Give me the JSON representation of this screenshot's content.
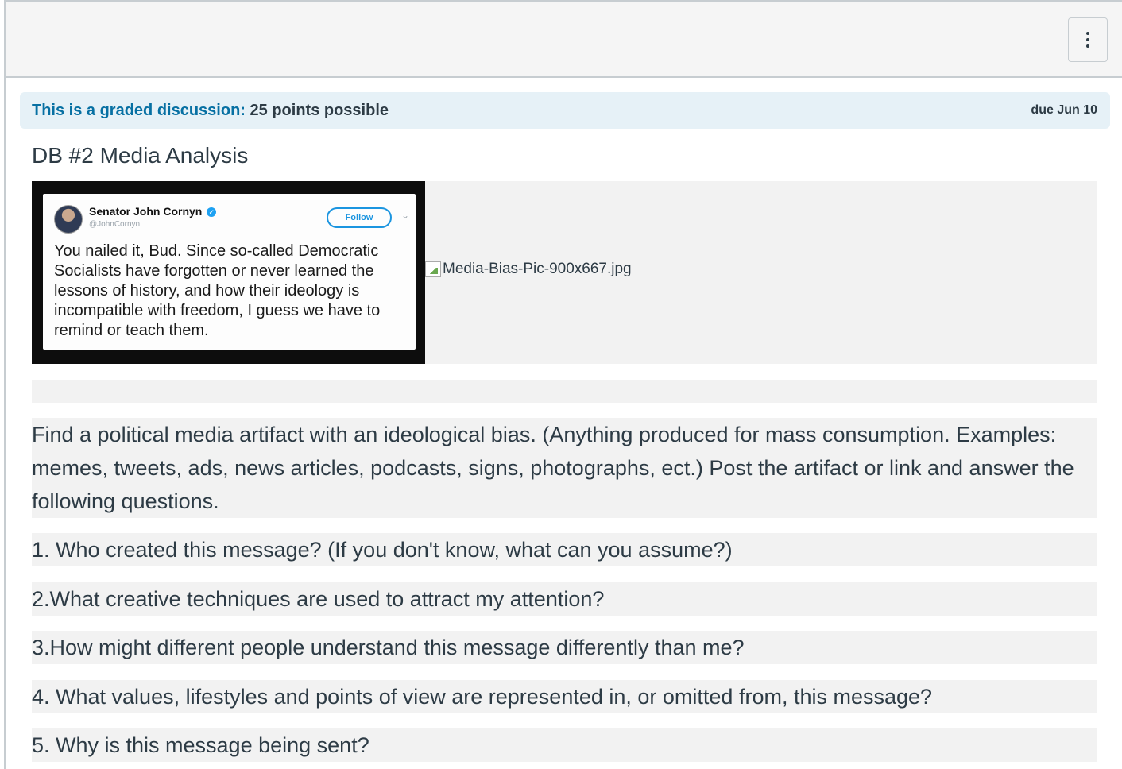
{
  "header": {
    "menu_icon": "kebab-vertical-icon"
  },
  "graded": {
    "link_text": "This is a graded discussion:",
    "points_text": " 25 points possible",
    "due_text": "due Jun 10"
  },
  "discussion": {
    "title": "DB #2 Media Analysis",
    "image_alt": "Media-Bias-Pic-900x667.jpg",
    "tweet": {
      "author": "Senator John Cornyn",
      "handle": "@JohnCornyn",
      "follow_label": "Follow",
      "text": "You nailed it, Bud.  Since so-called Democratic Socialists have forgotten or never learned the lessons of history, and how their ideology is incompatible with freedom, I guess we have to remind or teach them."
    },
    "prompt": "Find a political media artifact with an ideological bias. (Anything produced for mass consumption. Examples: memes, tweets, ads, news articles, podcasts, signs, photographs, ect.) Post the artifact or link and answer the following questions.",
    "questions": [
      "1. Who created this message? (If you don't know, what can you assume?)",
      "2.What creative techniques are used to attract my attention?",
      "3.How might different people understand this message differently than me?",
      "4. What values, lifestyles and points of view are represented in, or omitted from, this message?",
      "5. Why is this message being sent?"
    ]
  },
  "colors": {
    "graded_link": "#0770a3",
    "graded_bg": "#e6f1f7",
    "text": "#2d3b45",
    "block_bg": "#f2f2f2"
  }
}
